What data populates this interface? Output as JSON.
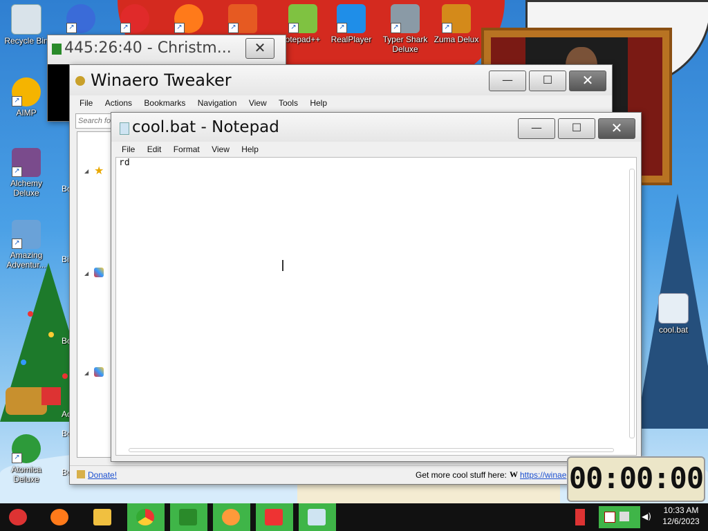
{
  "desktop": {
    "icons": [
      {
        "label": "Recycle Bin",
        "icon": "recycle-bin-icon"
      },
      {
        "label": "AIMP",
        "icon": "aimp-icon"
      },
      {
        "label": "Alchemy Deluxe",
        "icon": "alchemy-icon"
      },
      {
        "label": "Amazing Adventur...",
        "icon": "amazing-adventures-icon"
      },
      {
        "label": "Atomica Deluxe",
        "icon": "atomica-icon"
      },
      {
        "label": "otepad++",
        "icon": "notepadpp-icon"
      },
      {
        "label": "RealPlayer",
        "icon": "realplayer-icon"
      },
      {
        "label": "Typer Shark Deluxe",
        "icon": "typer-shark-icon"
      },
      {
        "label": "Zuma Delux",
        "icon": "zuma-icon"
      },
      {
        "label": "cool.bat",
        "icon": "bat-file-icon"
      }
    ],
    "partial_labels": [
      "Bo",
      "Bi",
      "Bo",
      "Bo",
      "Ao",
      "Bo"
    ]
  },
  "countdown_window": {
    "title": "445:26:40 - Christm...",
    "close": "✕"
  },
  "winaero": {
    "title": "Winaero Tweaker",
    "menu": [
      "File",
      "Actions",
      "Bookmarks",
      "Navigation",
      "View",
      "Tools",
      "Help"
    ],
    "search_placeholder": "Search fo",
    "footer_donate": "Donate!",
    "footer_more": "Get more cool stuff here:",
    "footer_w": "W",
    "footer_link": "https://winae",
    "buttons": {
      "min": "—",
      "max": "☐",
      "close": "✕"
    }
  },
  "notepad": {
    "title": "cool.bat - Notepad",
    "menu": [
      "File",
      "Edit",
      "Format",
      "View",
      "Help"
    ],
    "content": "rd",
    "buttons": {
      "min": "—",
      "max": "☐",
      "close": "✕"
    }
  },
  "timer_widget": {
    "display": "00:00:00"
  },
  "taskbar": {
    "clock_time": "10:33 AM",
    "clock_date": "12/6/2023",
    "items": [
      "santa-start-icon",
      "firefox-icon",
      "file-explorer-icon",
      "chrome-icon",
      "christmas-tree-icon",
      "firefox-icon",
      "anydesk-icon",
      "notepad-icon"
    ]
  },
  "colors": {
    "taskbar_highlight": "#3fb548",
    "title_bar": "#ececec",
    "accent_link": "#1a4fd0"
  }
}
